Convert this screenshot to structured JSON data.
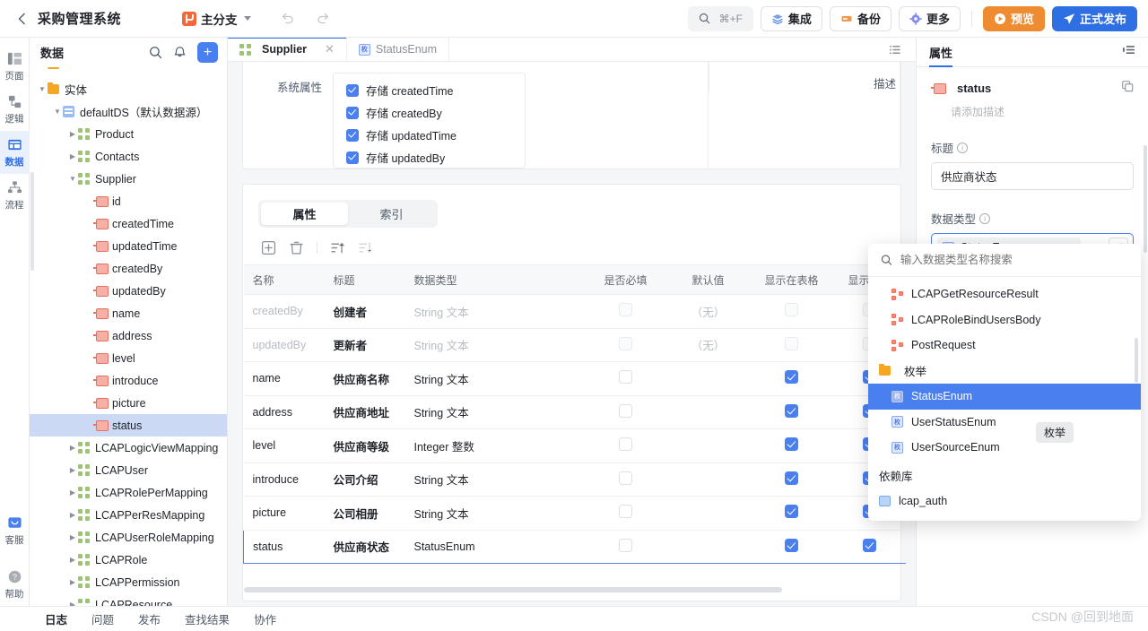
{
  "topbar": {
    "back_icon": "chevron-left-icon",
    "app_title": "采购管理系统",
    "branch_label": "主分支",
    "undo_icon": "undo-icon",
    "redo_icon": "redo-icon",
    "search_icon": "search-icon",
    "search_shortcut": "⌘+F",
    "buttons": [
      {
        "label": "集成",
        "icon": "integration-icon"
      },
      {
        "label": "备份",
        "icon": "backup-icon"
      },
      {
        "label": "更多",
        "icon": "gear-icon"
      }
    ],
    "preview_label": "预览",
    "publish_label": "正式发布"
  },
  "rail": {
    "items": [
      {
        "label": "页面",
        "icon": "page-icon",
        "active": false
      },
      {
        "label": "逻辑",
        "icon": "logic-icon",
        "active": false
      },
      {
        "label": "数据",
        "icon": "data-icon",
        "active": true
      },
      {
        "label": "流程",
        "icon": "flow-icon",
        "active": false
      }
    ],
    "bottom": [
      {
        "label": "客服",
        "icon": "support-icon"
      },
      {
        "label": "帮助",
        "icon": "help-icon"
      }
    ]
  },
  "sidebar": {
    "title": "数据",
    "search_icon": "search-icon",
    "bell_icon": "bell-icon",
    "add_label": "+",
    "tree": [
      {
        "label": "",
        "depth": 1,
        "icon": "orange-bar",
        "twisty": "",
        "clipped": true
      },
      {
        "label": "实体",
        "depth": 1,
        "icon": "folder",
        "twisty": "down"
      },
      {
        "label": "defaultDS（默认数据源）",
        "depth": 2,
        "icon": "datasource",
        "twisty": "down"
      },
      {
        "label": "Product",
        "depth": 3,
        "icon": "entity",
        "twisty": "right"
      },
      {
        "label": "Contacts",
        "depth": 3,
        "icon": "entity",
        "twisty": "right"
      },
      {
        "label": "Supplier",
        "depth": 3,
        "icon": "entity",
        "twisty": "down"
      },
      {
        "label": "id",
        "depth": 4,
        "icon": "field",
        "twisty": ""
      },
      {
        "label": "createdTime",
        "depth": 4,
        "icon": "field",
        "twisty": ""
      },
      {
        "label": "updatedTime",
        "depth": 4,
        "icon": "field",
        "twisty": ""
      },
      {
        "label": "createdBy",
        "depth": 4,
        "icon": "field",
        "twisty": ""
      },
      {
        "label": "updatedBy",
        "depth": 4,
        "icon": "field",
        "twisty": ""
      },
      {
        "label": "name",
        "depth": 4,
        "icon": "field",
        "twisty": ""
      },
      {
        "label": "address",
        "depth": 4,
        "icon": "field",
        "twisty": ""
      },
      {
        "label": "level",
        "depth": 4,
        "icon": "field",
        "twisty": ""
      },
      {
        "label": "introduce",
        "depth": 4,
        "icon": "field",
        "twisty": ""
      },
      {
        "label": "picture",
        "depth": 4,
        "icon": "field",
        "twisty": ""
      },
      {
        "label": "status",
        "depth": 4,
        "icon": "field",
        "twisty": "",
        "selected": true
      },
      {
        "label": "LCAPLogicViewMapping",
        "depth": 3,
        "icon": "entity",
        "twisty": "right"
      },
      {
        "label": "LCAPUser",
        "depth": 3,
        "icon": "entity",
        "twisty": "right"
      },
      {
        "label": "LCAPRolePerMapping",
        "depth": 3,
        "icon": "entity",
        "twisty": "right"
      },
      {
        "label": "LCAPPerResMapping",
        "depth": 3,
        "icon": "entity",
        "twisty": "right"
      },
      {
        "label": "LCAPUserRoleMapping",
        "depth": 3,
        "icon": "entity",
        "twisty": "right"
      },
      {
        "label": "LCAPRole",
        "depth": 3,
        "icon": "entity",
        "twisty": "right"
      },
      {
        "label": "LCAPPermission",
        "depth": 3,
        "icon": "entity",
        "twisty": "right"
      },
      {
        "label": "LCAPResource",
        "depth": 3,
        "icon": "entity",
        "twisty": "right"
      }
    ]
  },
  "editor": {
    "tabs": [
      {
        "label": "Supplier",
        "icon": "entity-icon",
        "active": true,
        "closable": true
      },
      {
        "label": "StatusEnum",
        "icon": "enum-icon",
        "active": false,
        "closable": false
      }
    ],
    "list_icon": "list-view-icon",
    "sysattr_label": "系统属性",
    "sysattr_checks": [
      {
        "label": "存储 createdTime",
        "checked": true
      },
      {
        "label": "存储 createdBy",
        "checked": true
      },
      {
        "label": "存储 updatedTime",
        "checked": true
      },
      {
        "label": "存储 updatedBy",
        "checked": true
      }
    ],
    "desc_label": "描述",
    "segmented": [
      {
        "label": "属性",
        "active": true
      },
      {
        "label": "索引",
        "active": false
      }
    ],
    "tools": [
      {
        "icon": "add-box-icon"
      },
      {
        "icon": "delete-icon"
      },
      {
        "icon": "sort-asc-icon"
      },
      {
        "icon": "sort-desc-icon"
      }
    ],
    "table": {
      "headers": [
        "名称",
        "标题",
        "数据类型",
        "是否必填",
        "默认值",
        "显示在表格",
        "显示在筛"
      ],
      "rows": [
        {
          "name": "createdBy",
          "title": "创建者",
          "type": "String 文本",
          "required": false,
          "default": "（无）",
          "in_table": false,
          "in_filter": false,
          "dim": true
        },
        {
          "name": "updatedBy",
          "title": "更新者",
          "type": "String 文本",
          "required": false,
          "default": "（无）",
          "in_table": false,
          "in_filter": false,
          "dim": true
        },
        {
          "name": "name",
          "title": "供应商名称",
          "type": "String 文本",
          "required": false,
          "default": "",
          "in_table": true,
          "in_filter": true,
          "dim": false
        },
        {
          "name": "address",
          "title": "供应商地址",
          "type": "String 文本",
          "required": false,
          "default": "",
          "in_table": true,
          "in_filter": true,
          "dim": false
        },
        {
          "name": "level",
          "title": "供应商等级",
          "type": "Integer 整数",
          "required": false,
          "default": "",
          "in_table": true,
          "in_filter": true,
          "dim": false
        },
        {
          "name": "introduce",
          "title": "公司介绍",
          "type": "String 文本",
          "required": false,
          "default": "",
          "in_table": true,
          "in_filter": true,
          "dim": false
        },
        {
          "name": "picture",
          "title": "公司相册",
          "type": "String 文本",
          "required": false,
          "default": "",
          "in_table": true,
          "in_filter": true,
          "dim": false
        },
        {
          "name": "status",
          "title": "供应商状态",
          "type": "StatusEnum",
          "required": false,
          "default": "",
          "in_table": true,
          "in_filter": true,
          "dim": false,
          "selected": true
        }
      ]
    }
  },
  "right_panel": {
    "tab_label": "属性",
    "panel_icon": "panel-collapse-icon",
    "field_icon": "field-icon",
    "field_name": "status",
    "copy_icon": "copy-icon",
    "description_placeholder": "请添加描述",
    "title_label": "标题",
    "title_value": "供应商状态",
    "datatype_label": "数据类型",
    "datatype_value": "StatusEnum",
    "datatype_icon": "enum-icon",
    "chevron_icon": "chevron-up-icon",
    "expand_icon": "expand-icon"
  },
  "dropdown": {
    "search_icon": "search-icon",
    "search_placeholder": "输入数据类型名称搜索",
    "items": [
      {
        "label": "LCAPGetResourceResult",
        "icon": "struct-icon",
        "kind": "item"
      },
      {
        "label": "LCAPRoleBindUsersBody",
        "icon": "struct-icon",
        "kind": "item"
      },
      {
        "label": "PostRequest",
        "icon": "struct-icon",
        "kind": "item"
      },
      {
        "label": "枚举",
        "icon": "folder-icon",
        "kind": "group"
      },
      {
        "label": "StatusEnum",
        "icon": "enum-icon",
        "kind": "item",
        "selected": true
      },
      {
        "label": "UserStatusEnum",
        "icon": "enum-icon",
        "kind": "item"
      },
      {
        "label": "UserSourceEnum",
        "icon": "enum-icon",
        "kind": "item"
      }
    ],
    "section_label": "依赖库",
    "lib_items": [
      {
        "label": "lcap_auth",
        "icon": "library-icon"
      }
    ],
    "tooltip": "枚举"
  },
  "bottombar": {
    "items": [
      {
        "label": "日志",
        "active": true
      },
      {
        "label": "问题",
        "active": false
      },
      {
        "label": "发布",
        "active": false
      },
      {
        "label": "查找结果",
        "active": false
      },
      {
        "label": "协作",
        "active": false
      }
    ]
  },
  "watermark": "CSDN @回到地面",
  "colors": {
    "accent_blue": "#2f6fe4",
    "check_blue": "#4a7ff0",
    "orange": "#ef8c32",
    "selected_row": "#ccd9f5"
  }
}
